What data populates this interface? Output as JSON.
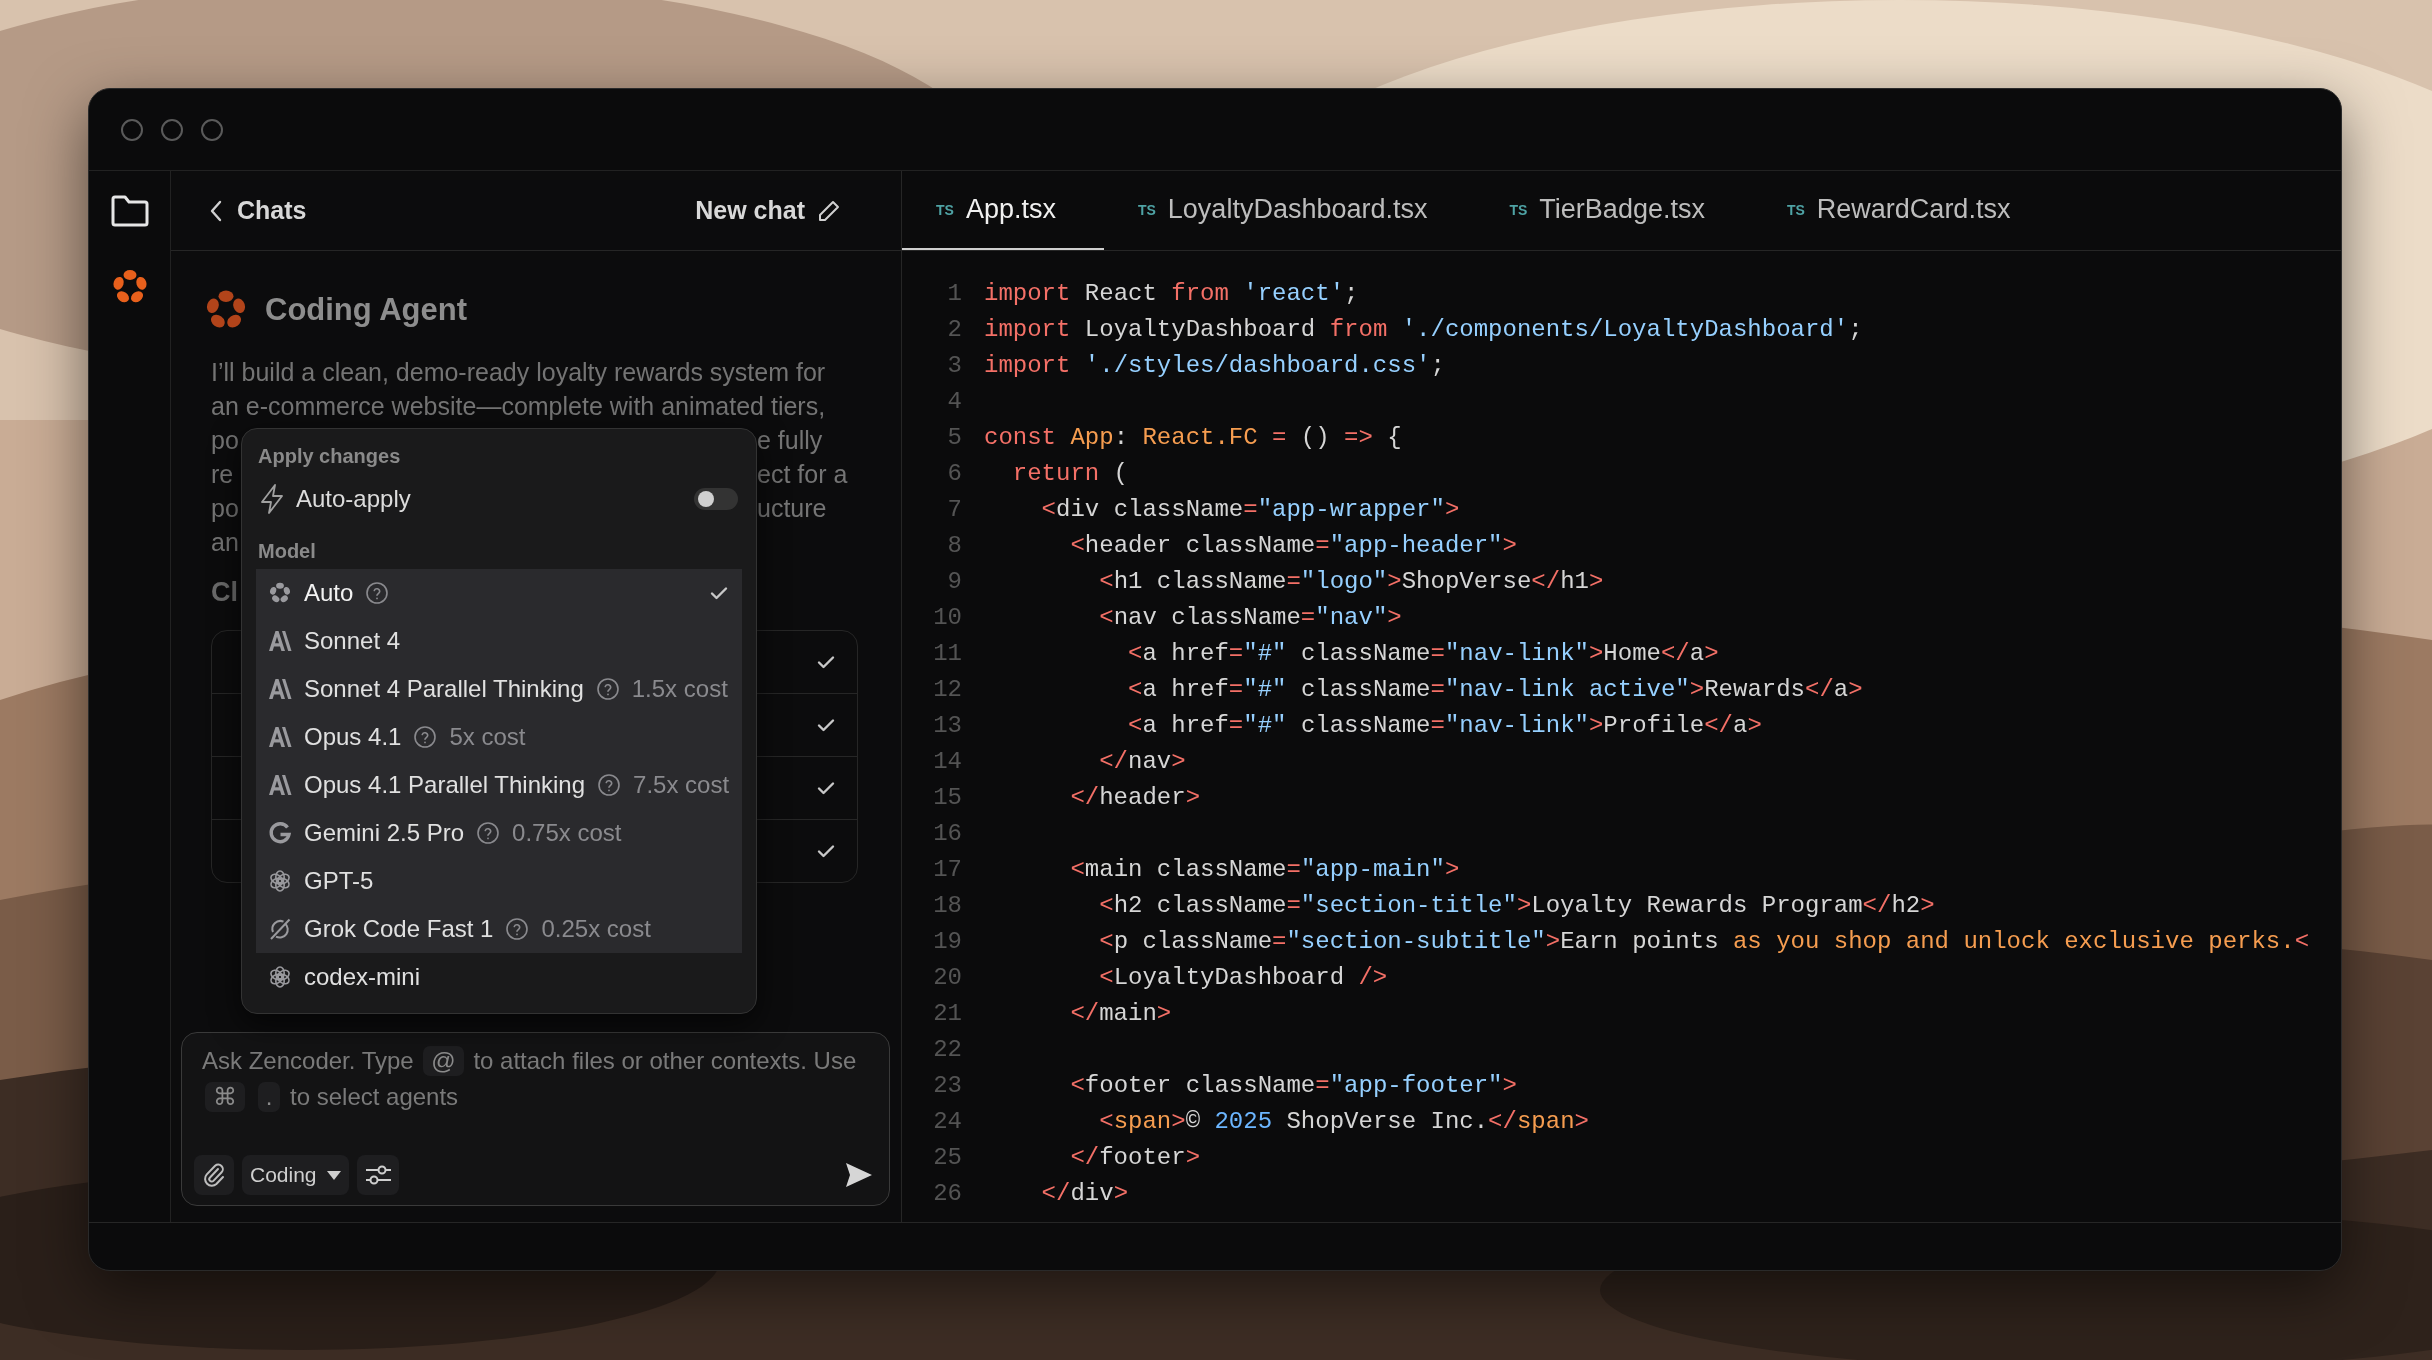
{
  "chat_header": {
    "back_label": "Chats",
    "new_chat_label": "New chat"
  },
  "agent": {
    "title": "Coding Agent"
  },
  "message": {
    "full_lines": [
      "I’ll build a clean, demo-ready loyalty rewards system for",
      "an e-commerce website—complete with animated tiers,"
    ],
    "covered_lines": [
      {
        "left": "po",
        "right": "e fully"
      },
      {
        "left": "re",
        "right": "ect for a"
      },
      {
        "left": "po",
        "right": "ucture"
      },
      {
        "left": "an"
      }
    ]
  },
  "section_heading": "Cl",
  "tasks": [
    {
      "checked": true
    },
    {
      "checked": true
    },
    {
      "checked": true
    },
    {
      "checked": true
    }
  ],
  "composer": {
    "hint_parts": [
      {
        "kind": "text",
        "text": "Ask Zencoder. Type"
      },
      {
        "kind": "key",
        "text": "@"
      },
      {
        "kind": "text",
        "text": "to attach files or other contexts. Use"
      },
      {
        "kind": "key",
        "text": "⌘"
      },
      {
        "kind": "key",
        "text": "."
      },
      {
        "kind": "text",
        "text": "to select agents"
      }
    ],
    "mode": "Coding"
  },
  "menu": {
    "apply_heading": "Apply changes",
    "auto_apply": {
      "label": "Auto-apply",
      "on": false
    },
    "model_heading": "Model",
    "models": [
      {
        "kind": "flower",
        "name": "Auto",
        "help": true,
        "selected": true,
        "highlighted": true
      },
      {
        "kind": "slash",
        "name": "Sonnet 4",
        "help": false,
        "selected": false,
        "highlighted": true
      },
      {
        "kind": "slash",
        "name": "Sonnet 4 Parallel Thinking",
        "help": true,
        "cost": "1.5x cost",
        "selected": false,
        "highlighted": true
      },
      {
        "kind": "slash",
        "name": "Opus 4.1",
        "help": true,
        "cost": "5x cost",
        "selected": false,
        "highlighted": true
      },
      {
        "kind": "slash",
        "name": "Opus 4.1 Parallel Thinking",
        "help": true,
        "cost": "7.5x cost",
        "selected": false,
        "highlighted": true
      },
      {
        "kind": "g",
        "name": "Gemini 2.5 Pro",
        "help": true,
        "cost": "0.75x cost",
        "selected": false,
        "highlighted": true
      },
      {
        "kind": "knot",
        "name": "GPT-5",
        "help": false,
        "selected": false,
        "highlighted": true
      },
      {
        "kind": "circle",
        "name": "Grok Code Fast 1",
        "help": true,
        "cost": "0.25x cost",
        "selected": false,
        "highlighted": true
      },
      {
        "kind": "knot",
        "name": "codex-mini",
        "help": false,
        "selected": false,
        "highlighted": false
      }
    ]
  },
  "tabs": [
    {
      "badge": "TS",
      "label": "App.tsx",
      "selected": true
    },
    {
      "badge": "TS",
      "label": "LoyaltyDashboard.tsx",
      "selected": false
    },
    {
      "badge": "TS",
      "label": "TierBadge.tsx",
      "selected": false
    },
    {
      "badge": "TS",
      "label": "RewardCard.tsx",
      "selected": false
    }
  ],
  "code": [
    {
      "number": "1",
      "tokens": [
        {
          "kind": "keyword",
          "text": "import"
        },
        {
          "kind": "plain",
          "text": " React "
        },
        {
          "kind": "keyword",
          "text": "from"
        },
        {
          "kind": "string",
          "text": " 'react'"
        },
        {
          "kind": "plain",
          "text": ";"
        }
      ]
    },
    {
      "number": "2",
      "tokens": [
        {
          "kind": "keyword",
          "text": "import"
        },
        {
          "kind": "plain",
          "text": " LoyaltyDashboard "
        },
        {
          "kind": "keyword",
          "text": "from"
        },
        {
          "kind": "string",
          "text": " './components/LoyaltyDashboard'"
        },
        {
          "kind": "plain",
          "text": ";"
        }
      ]
    },
    {
      "number": "3",
      "tokens": [
        {
          "kind": "keyword",
          "text": "import"
        },
        {
          "kind": "string",
          "text": " './styles/dashboard.css'"
        },
        {
          "kind": "plain",
          "text": ";"
        }
      ]
    },
    {
      "number": "4"
    },
    {
      "number": "5",
      "tokens": [
        {
          "kind": "keyword",
          "text": "const"
        },
        {
          "kind": "type",
          "text": " App"
        },
        {
          "kind": "plain",
          "text": ": "
        },
        {
          "kind": "type",
          "text": "React.FC"
        },
        {
          "kind": "keyword",
          "text": " ="
        },
        {
          "kind": "plain",
          "text": " () "
        },
        {
          "kind": "keyword",
          "text": "=>"
        },
        {
          "kind": "plain",
          "text": " {"
        }
      ]
    },
    {
      "number": "6",
      "tokens": [
        {
          "kind": "keyword",
          "text": "  return"
        },
        {
          "kind": "plain",
          "text": " ("
        }
      ]
    },
    {
      "number": "7",
      "tokens": [
        {
          "kind": "keyword",
          "text": "    <"
        },
        {
          "kind": "plain",
          "text": "div className"
        },
        {
          "kind": "keyword",
          "text": "="
        },
        {
          "kind": "string",
          "text": "\"app-wrapper\""
        },
        {
          "kind": "keyword",
          "text": ">"
        }
      ]
    },
    {
      "number": "8",
      "tokens": [
        {
          "kind": "keyword",
          "text": "      <"
        },
        {
          "kind": "plain",
          "text": "header className"
        },
        {
          "kind": "keyword",
          "text": "="
        },
        {
          "kind": "string",
          "text": "\"app-header\""
        },
        {
          "kind": "keyword",
          "text": ">"
        }
      ]
    },
    {
      "number": "9",
      "tokens": [
        {
          "kind": "keyword",
          "text": "        <"
        },
        {
          "kind": "plain",
          "text": "h1 className"
        },
        {
          "kind": "keyword",
          "text": "="
        },
        {
          "kind": "string",
          "text": "\"logo\""
        },
        {
          "kind": "keyword",
          "text": ">"
        },
        {
          "kind": "plain",
          "text": "ShopVerse"
        },
        {
          "kind": "keyword",
          "text": "</"
        },
        {
          "kind": "plain",
          "text": "h1"
        },
        {
          "kind": "keyword",
          "text": ">"
        }
      ]
    },
    {
      "number": "10",
      "tokens": [
        {
          "kind": "keyword",
          "text": "        <"
        },
        {
          "kind": "plain",
          "text": "nav className"
        },
        {
          "kind": "keyword",
          "text": "="
        },
        {
          "kind": "string",
          "text": "\"nav\""
        },
        {
          "kind": "keyword",
          "text": ">"
        }
      ]
    },
    {
      "number": "11",
      "tokens": [
        {
          "kind": "keyword",
          "text": "          <"
        },
        {
          "kind": "plain",
          "text": "a href"
        },
        {
          "kind": "keyword",
          "text": "="
        },
        {
          "kind": "string",
          "text": "\"#\""
        },
        {
          "kind": "plain",
          "text": " className"
        },
        {
          "kind": "keyword",
          "text": "="
        },
        {
          "kind": "string",
          "text": "\"nav-link\""
        },
        {
          "kind": "keyword",
          "text": ">"
        },
        {
          "kind": "plain",
          "text": "Home"
        },
        {
          "kind": "keyword",
          "text": "</"
        },
        {
          "kind": "plain",
          "text": "a"
        },
        {
          "kind": "keyword",
          "text": ">"
        }
      ]
    },
    {
      "number": "12",
      "tokens": [
        {
          "kind": "keyword",
          "text": "          <"
        },
        {
          "kind": "plain",
          "text": "a href"
        },
        {
          "kind": "keyword",
          "text": "="
        },
        {
          "kind": "string",
          "text": "\"#\""
        },
        {
          "kind": "plain",
          "text": " className"
        },
        {
          "kind": "keyword",
          "text": "="
        },
        {
          "kind": "string",
          "text": "\"nav-link active\""
        },
        {
          "kind": "keyword",
          "text": ">"
        },
        {
          "kind": "plain",
          "text": "Rewards"
        },
        {
          "kind": "keyword",
          "text": "</"
        },
        {
          "kind": "plain",
          "text": "a"
        },
        {
          "kind": "keyword",
          "text": ">"
        }
      ]
    },
    {
      "number": "13",
      "tokens": [
        {
          "kind": "keyword",
          "text": "          <"
        },
        {
          "kind": "plain",
          "text": "a href"
        },
        {
          "kind": "keyword",
          "text": "="
        },
        {
          "kind": "string",
          "text": "\"#\""
        },
        {
          "kind": "plain",
          "text": " className"
        },
        {
          "kind": "keyword",
          "text": "="
        },
        {
          "kind": "string",
          "text": "\"nav-link\""
        },
        {
          "kind": "keyword",
          "text": ">"
        },
        {
          "kind": "plain",
          "text": "Profile"
        },
        {
          "kind": "keyword",
          "text": "</"
        },
        {
          "kind": "plain",
          "text": "a"
        },
        {
          "kind": "keyword",
          "text": ">"
        }
      ]
    },
    {
      "number": "14",
      "tokens": [
        {
          "kind": "keyword",
          "text": "        </"
        },
        {
          "kind": "plain",
          "text": "nav"
        },
        {
          "kind": "keyword",
          "text": ">"
        }
      ]
    },
    {
      "number": "15",
      "tokens": [
        {
          "kind": "keyword",
          "text": "      </"
        },
        {
          "kind": "plain",
          "text": "header"
        },
        {
          "kind": "keyword",
          "text": ">"
        }
      ]
    },
    {
      "number": "16"
    },
    {
      "number": "17",
      "tokens": [
        {
          "kind": "keyword",
          "text": "      <"
        },
        {
          "kind": "plain",
          "text": "main className"
        },
        {
          "kind": "keyword",
          "text": "="
        },
        {
          "kind": "string",
          "text": "\"app-main\""
        },
        {
          "kind": "keyword",
          "text": ">"
        }
      ]
    },
    {
      "number": "18",
      "tokens": [
        {
          "kind": "keyword",
          "text": "        <"
        },
        {
          "kind": "plain",
          "text": "h2 className"
        },
        {
          "kind": "keyword",
          "text": "="
        },
        {
          "kind": "string",
          "text": "\"section-title\""
        },
        {
          "kind": "keyword",
          "text": ">"
        },
        {
          "kind": "plain",
          "text": "Loyalty Rewards Program"
        },
        {
          "kind": "keyword",
          "text": "</"
        },
        {
          "kind": "plain",
          "text": "h2"
        },
        {
          "kind": "keyword",
          "text": ">"
        }
      ]
    },
    {
      "number": "19",
      "tokens": [
        {
          "kind": "keyword",
          "text": "        <"
        },
        {
          "kind": "plain",
          "text": "p className"
        },
        {
          "kind": "keyword",
          "text": "="
        },
        {
          "kind": "string",
          "text": "\"section-subtitle\""
        },
        {
          "kind": "keyword",
          "text": ">"
        },
        {
          "kind": "plain",
          "text": "Earn points "
        },
        {
          "kind": "type",
          "text": "as you shop and unlock exclusive perks."
        },
        {
          "kind": "keyword",
          "text": "<"
        }
      ]
    },
    {
      "number": "20",
      "tokens": [
        {
          "kind": "keyword",
          "text": "        <"
        },
        {
          "kind": "plain",
          "text": "LoyaltyDashboard "
        },
        {
          "kind": "keyword",
          "text": "/>"
        }
      ]
    },
    {
      "number": "21",
      "tokens": [
        {
          "kind": "keyword",
          "text": "      </"
        },
        {
          "kind": "plain",
          "text": "main"
        },
        {
          "kind": "keyword",
          "text": ">"
        }
      ]
    },
    {
      "number": "22"
    },
    {
      "number": "23",
      "tokens": [
        {
          "kind": "keyword",
          "text": "      <"
        },
        {
          "kind": "plain",
          "text": "footer className"
        },
        {
          "kind": "keyword",
          "text": "="
        },
        {
          "kind": "string",
          "text": "\"app-footer\""
        },
        {
          "kind": "keyword",
          "text": ">"
        }
      ]
    },
    {
      "number": "24",
      "tokens": [
        {
          "kind": "keyword",
          "text": "        <"
        },
        {
          "kind": "type",
          "text": "span"
        },
        {
          "kind": "keyword",
          "text": ">"
        },
        {
          "kind": "plain",
          "text": "© "
        },
        {
          "kind": "number",
          "text": "2025"
        },
        {
          "kind": "plain",
          "text": " ShopVerse Inc."
        },
        {
          "kind": "keyword",
          "text": "</"
        },
        {
          "kind": "type",
          "text": "span"
        },
        {
          "kind": "keyword",
          "text": ">"
        }
      ]
    },
    {
      "number": "25",
      "tokens": [
        {
          "kind": "keyword",
          "text": "      </"
        },
        {
          "kind": "plain",
          "text": "footer"
        },
        {
          "kind": "keyword",
          "text": ">"
        }
      ]
    },
    {
      "number": "26",
      "tokens": [
        {
          "kind": "keyword",
          "text": "    </"
        },
        {
          "kind": "plain",
          "text": "div"
        },
        {
          "kind": "keyword",
          "text": ">"
        }
      ]
    }
  ]
}
